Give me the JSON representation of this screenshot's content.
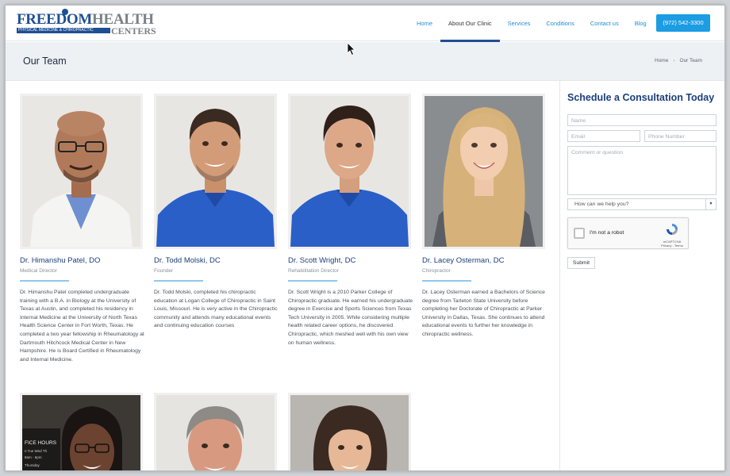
{
  "logo": {
    "part1": "FREEDOM",
    "part2": "HEALTH",
    "tagline": "PHYSICAL MEDICINE & CHIROPRACTIC",
    "part3": "CENTERS"
  },
  "nav": {
    "items": [
      "Home",
      "About Our Clinic",
      "Services",
      "Conditions",
      "Contact us",
      "Blog"
    ],
    "active": "About Our Clinic",
    "phone": "(972) 542-3300"
  },
  "band": {
    "title": "Our Team",
    "breadcrumb": [
      "Home",
      "Our Team"
    ]
  },
  "team": [
    {
      "name": "Dr. Himanshu Patel, DO",
      "role": "Medical Director",
      "bio": "Dr. Himanshu Patel completed undergraduate training with a B.A. in Biology at the University of Texas at Austin, and completed his residency in Internal Medicine at the University of North Texas Health Science Center in Fort Worth, Texas. He completed a two year fellowship in Rheumatology at Dartmouth Hitchcock Medical Center in New Hampshire. He is Board Certified in Rheumatology and Internal Medicine."
    },
    {
      "name": "Dr. Todd Molski, DC",
      "role": "Founder",
      "bio": "Dr. Todd Molski, completed his chiropractic education at Logan College of Chiropractic in Saint Louis, Missouri. He is very active in the Chiropractic community and attends many educational events and continuing education courses"
    },
    {
      "name": "Dr. Scott Wright, DC",
      "role": "Rehabilitation Director",
      "bio": "Dr. Scott Wright is a 2010 Parker College of Chiropractic graduate. He earned his undergraduate degree in Exercise and Sports Sciences from Texas Tech University in 2005. While considering multiple health related career options, he discovered Chiropractic, which meshed well with his own view on human wellness."
    },
    {
      "name": "Dr. Lacey Osterman, DC",
      "role": "Chiropractor",
      "bio": "Dr. Lacey Osterman earned a Bachelors of Science degree from Tarleton State University before completing her Doctorate of Chiropractic at Parker University in Dallas, Texas. She continues to attend educational events to further her knowledge in chiropractic wellness."
    }
  ],
  "photo_sign": [
    "FICE HOURS",
    "n  Tue  Wed  Th",
    "8am - 6pm",
    "Thursday"
  ],
  "form": {
    "title": "Schedule a Consultation Today",
    "name_placeholder": "Name",
    "email_placeholder": "Email",
    "phone_placeholder": "Phone Number",
    "comment_placeholder": "Comment or question",
    "select_value": "How can we help you?",
    "captcha_label": "I'm not a robot",
    "captcha_brand": "reCAPTCHA",
    "captcha_links": "Privacy - Terms",
    "submit_label": "Submit"
  },
  "colors": {
    "accent": "#1b9ce3",
    "navy": "#1c3f7a",
    "shirt_blue": "#2a5fc8"
  }
}
